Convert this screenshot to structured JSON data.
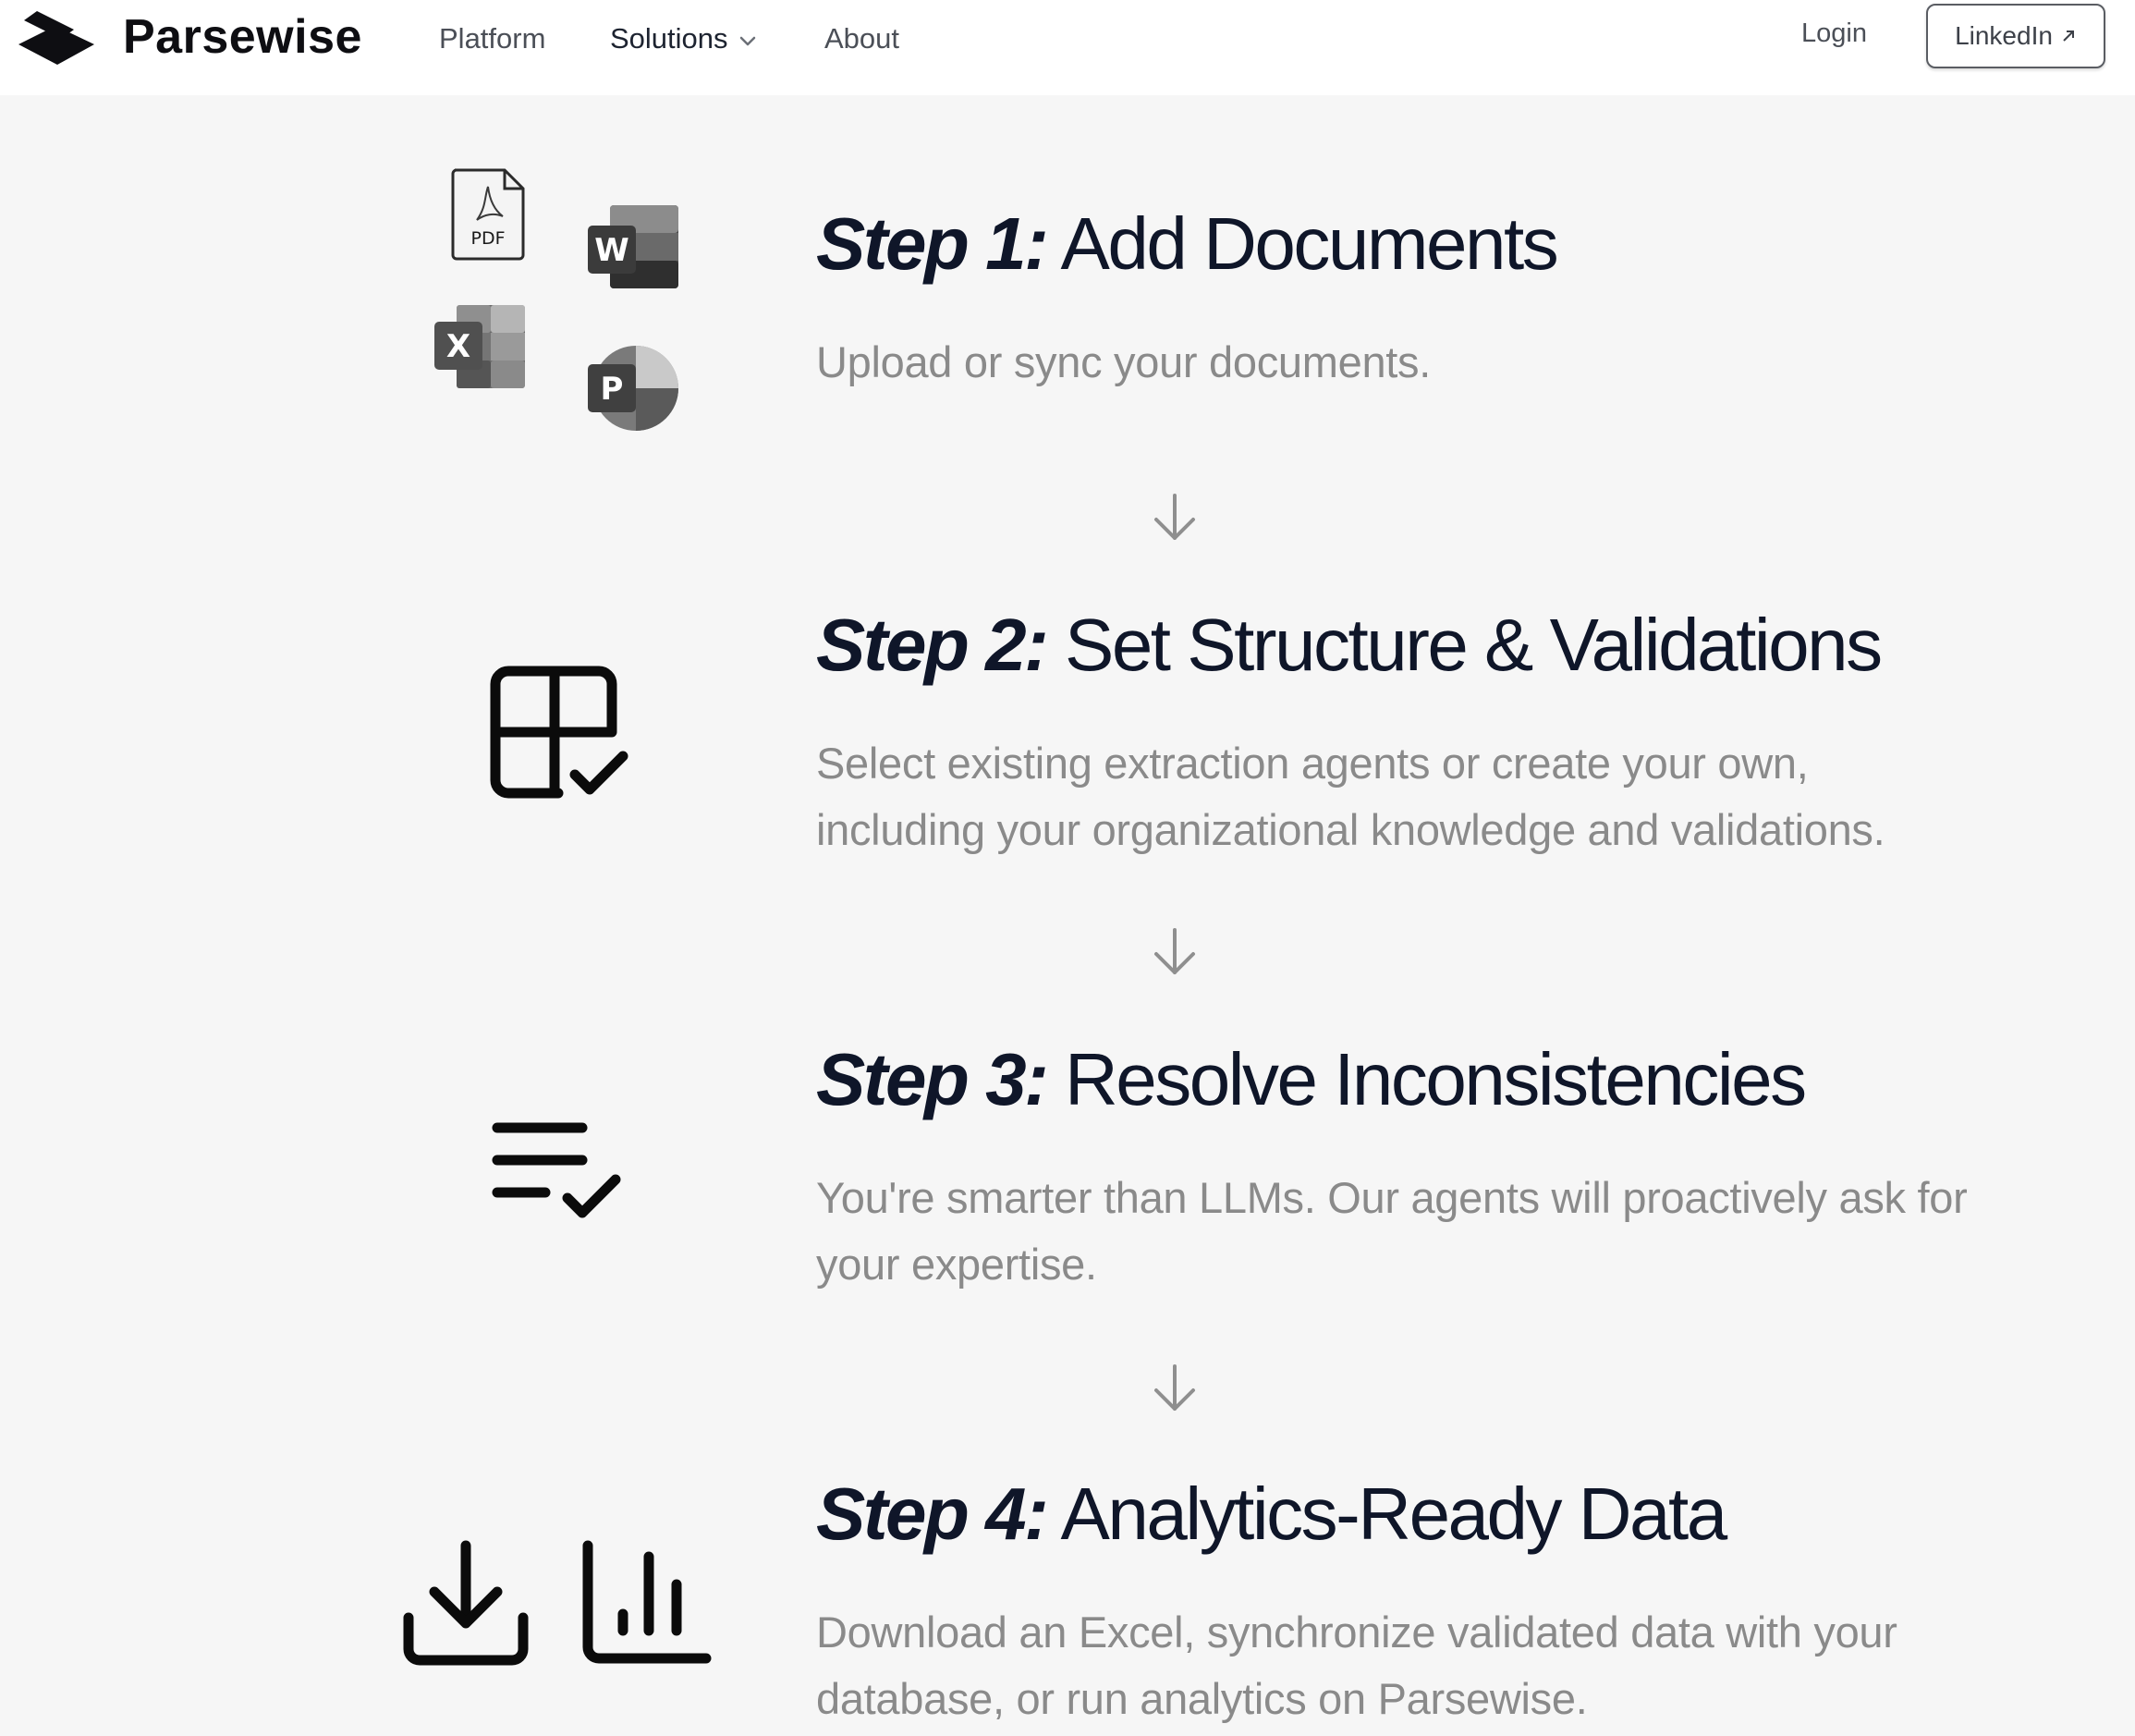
{
  "nav": {
    "brand": "Parsewise",
    "links": [
      {
        "label": "Platform"
      },
      {
        "label": "Solutions",
        "has_dropdown": true
      },
      {
        "label": "About"
      }
    ],
    "login": "Login",
    "linkedin": "LinkedIn"
  },
  "steps": [
    {
      "label": "Step 1:",
      "title": "Add Documents",
      "description": "Upload or sync your documents.",
      "icons": [
        "pdf-file-icon",
        "word-icon",
        "excel-icon",
        "powerpoint-icon"
      ]
    },
    {
      "label": "Step 2:",
      "title": "Set Structure & Validations",
      "description": "Select existing extraction agents or create your own, including your organizational knowledge and validations.",
      "icons": [
        "table-check-icon"
      ]
    },
    {
      "label": "Step 3:",
      "title": "Resolve Inconsistencies",
      "description": "You're smarter than LLMs. Our agents will proactively ask for your expertise.",
      "icons": [
        "list-check-icon"
      ]
    },
    {
      "label": "Step 4:",
      "title": "Analytics-Ready Data",
      "description": "Download an Excel, synchronize validated data with your database, or run analytics on Parsewise.",
      "icons": [
        "download-icon",
        "bar-chart-icon"
      ]
    }
  ],
  "icon_labels": {
    "pdf": "PDF",
    "word": "W",
    "excel": "X",
    "powerpoint": "P"
  },
  "colors": {
    "background": "#f6f6f6",
    "heading": "#0f1629",
    "description": "#8a8a8a",
    "arrow": "#8f8f8f"
  }
}
